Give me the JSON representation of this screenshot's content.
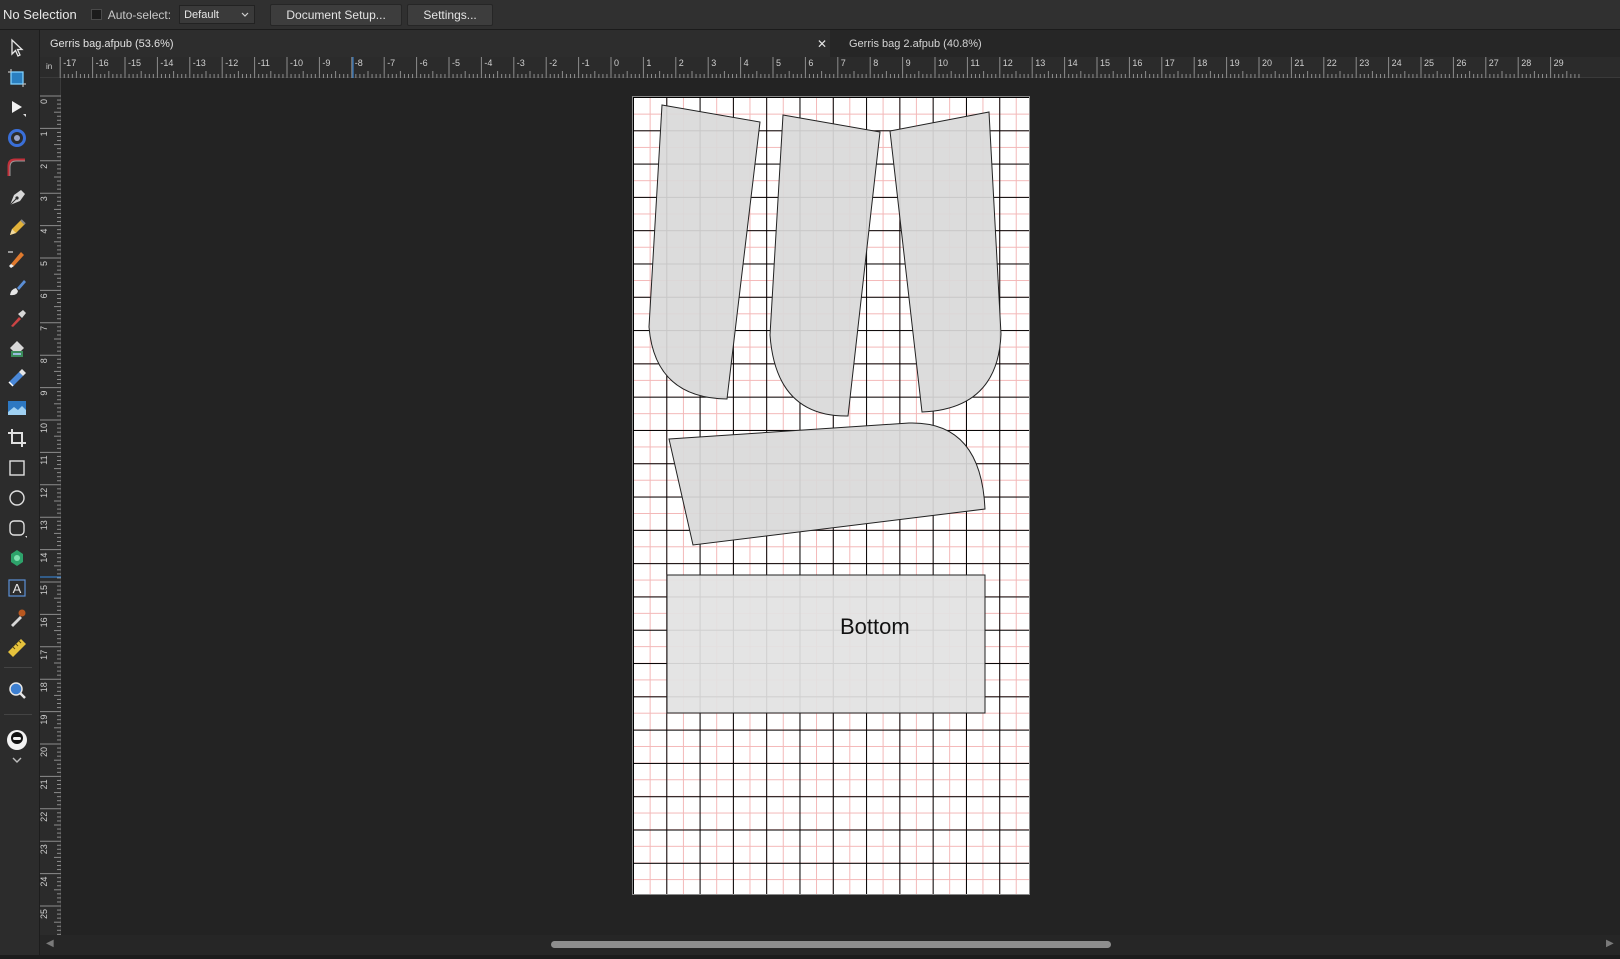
{
  "context_bar": {
    "selection_status": "No Selection",
    "autoselect_label": "Auto-select:",
    "autoselect_value": "Default",
    "document_setup_label": "Document Setup...",
    "settings_label": "Settings..."
  },
  "tabs": [
    {
      "label": "Gerris bag.afpub (53.6%)",
      "active": true
    },
    {
      "label": "Gerris bag 2.afpub (40.8%)",
      "active": false
    }
  ],
  "ruler": {
    "unit": "in",
    "h_labels": [
      "-17",
      "-16",
      "-15",
      "-14",
      "-13",
      "-12",
      "-11",
      "-10",
      "-9",
      "-8",
      "-7",
      "-6",
      "-5",
      "-4",
      "-3",
      "-2",
      "-1",
      "0",
      "1",
      "2",
      "3",
      "4",
      "5",
      "6",
      "7",
      "8",
      "9",
      "10",
      "11",
      "12",
      "13",
      "14",
      "15",
      "16",
      "17",
      "18",
      "19",
      "20",
      "21",
      "22",
      "23",
      "24",
      "25",
      "26",
      "27",
      "28",
      "29"
    ],
    "v_labels": [
      "0",
      "1",
      "2",
      "3",
      "4",
      "5",
      "6",
      "7",
      "8",
      "9",
      "10",
      "11",
      "12",
      "13",
      "14",
      "15",
      "16",
      "17",
      "18",
      "19",
      "20",
      "21",
      "22",
      "23",
      "24",
      "25"
    ]
  },
  "canvas": {
    "bottom_label": "Bottom"
  },
  "tools": [
    "move-tool-icon",
    "artboard-tool-icon",
    "node-tool-icon",
    "shape-builder-icon",
    "corner-tool-icon",
    "pen-tool-icon",
    "pencil-tool-icon",
    "vector-brush-icon",
    "paint-brush-icon",
    "color-picker-icon",
    "fill-tool-icon",
    "transparency-tool-icon",
    "picture-frame-icon",
    "crop-tool-icon",
    "rectangle-tool-icon",
    "ellipse-tool-icon",
    "rounded-rect-icon",
    "shape-tool-icon",
    "text-tool-icon",
    "table-tool-icon",
    "measure-tool-icon",
    "view-tool-icon",
    "persona-toggle-icon"
  ],
  "colors": {
    "panel_bg": "#2c2c2c",
    "canvas_bg": "#232323",
    "page_bg": "#ffffff",
    "piece_fill": "#d9d9d9",
    "grid_major": "#000000",
    "grid_minor": "#f3b7b7",
    "ruler_marker": "#3a8ee6"
  }
}
